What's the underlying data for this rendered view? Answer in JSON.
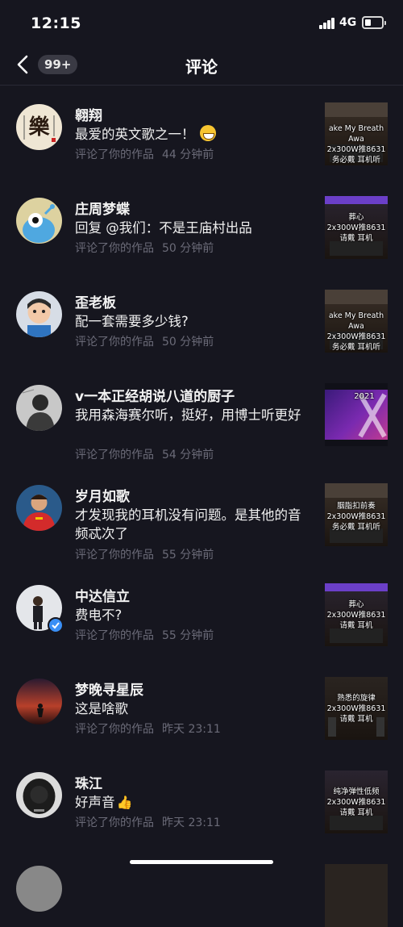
{
  "status": {
    "time": "12:15",
    "network": "4G"
  },
  "nav": {
    "badge": "99+",
    "title": "评论"
  },
  "comments": [
    {
      "username": "翱翔",
      "text": "最爱的英文歌之一！",
      "emoji": "grin-emoji",
      "action": "评论了你的作品",
      "time": "44 分钟前",
      "thumb_text": "ake My Breath Awa\n2x300W推8631\n务必戴 耳机听"
    },
    {
      "username": "庄周梦蝶",
      "text": "回复 @我们：不是王庙村出品",
      "action": "评论了你的作品",
      "time": "50 分钟前",
      "thumb_text": "葬心\n2x300W推8631\n请戴 耳机"
    },
    {
      "username": "歪老板",
      "text": "配一套需要多少钱?",
      "action": "评论了你的作品",
      "time": "50 分钟前",
      "thumb_text": "ake My Breath Awa\n2x300W推8631\n务必戴 耳机听"
    },
    {
      "username": "v一本正经胡说八道的厨子",
      "text": "我用森海赛尔听，挺好，用博士听更好",
      "action": "评论了你的作品",
      "time": "54 分钟前",
      "thumb_text": "2021"
    },
    {
      "username": "岁月如歌",
      "text": "才发现我的耳机没有问题。是其他的音频忒次了",
      "action": "评论了你的作品",
      "time": "55 分钟前",
      "thumb_text": "胭脂扣前奏\n2x300W推8631\n务必戴 耳机听"
    },
    {
      "username": "中达信立",
      "text": "费电不?",
      "action": "评论了你的作品",
      "time": "55 分钟前",
      "thumb_text": "葬心\n2x300W推8631\n请戴 耳机"
    },
    {
      "username": "梦晚寻星辰",
      "text": "这是啥歌",
      "action": "评论了你的作品",
      "time": "昨天 23:11",
      "thumb_text": "熟悉的旋律\n2x300W推8631\n请戴 耳机"
    },
    {
      "username": "珠江",
      "text": "好声音",
      "emoji": "thumbs-up-emoji",
      "action": "评论了你的作品",
      "time": "昨天 23:11",
      "thumb_text": "纯净弹性低频\n2x300W推8631\n请戴 耳机"
    }
  ],
  "colors": {
    "background": "#16161f",
    "meta_text": "#6b6b78",
    "badge_bg": "#3a3a44",
    "verified": "#3a8ff5"
  }
}
